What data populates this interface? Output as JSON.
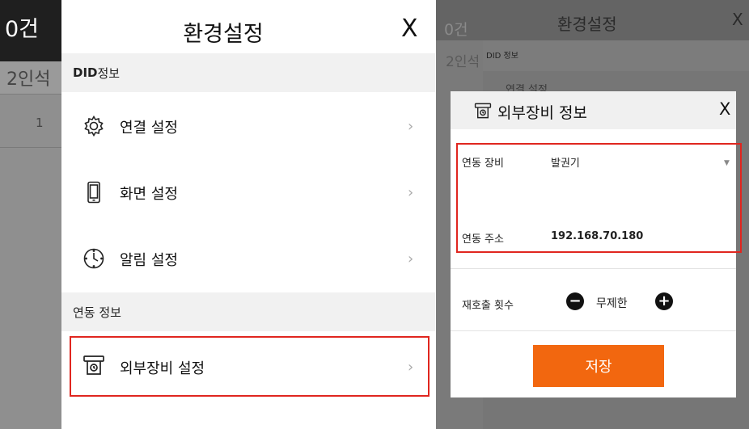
{
  "background": {
    "count": "0건",
    "people": "2인석",
    "row_number": "1"
  },
  "settings": {
    "title": "환경설정",
    "close_label": "X",
    "sections": {
      "did_bold": "DID",
      "did_rest": " 정보",
      "link": "연동 정보"
    },
    "items": {
      "connection": {
        "label": "연결 설정",
        "icon": "gear-icon"
      },
      "screen": {
        "label": "화면 설정",
        "icon": "phone-icon"
      },
      "alarm": {
        "label": "알림 설정",
        "icon": "clock-icon"
      },
      "external": {
        "label": "외부장비 설정",
        "icon": "printer-icon"
      }
    },
    "chevron": "›"
  },
  "right_background": {
    "count": "0건",
    "title": "환경설정",
    "close_label": "X",
    "people": "2인석",
    "did_label": "DID 정보",
    "peek_label": "연결 설정"
  },
  "dialog": {
    "title": "외부장비 정보",
    "close_label": "X",
    "device_label": "연동 장비",
    "device_value": "발권기",
    "dropdown_arrow": "▼",
    "address_label": "연동 주소",
    "address_value": "192.168.70.180",
    "recall_label": "재호출 횟수",
    "recall_value": "무제한",
    "minus": "−",
    "plus": "+",
    "save_label": "저장",
    "accent_color": "#f2670f",
    "highlight_color": "#e0261f"
  }
}
